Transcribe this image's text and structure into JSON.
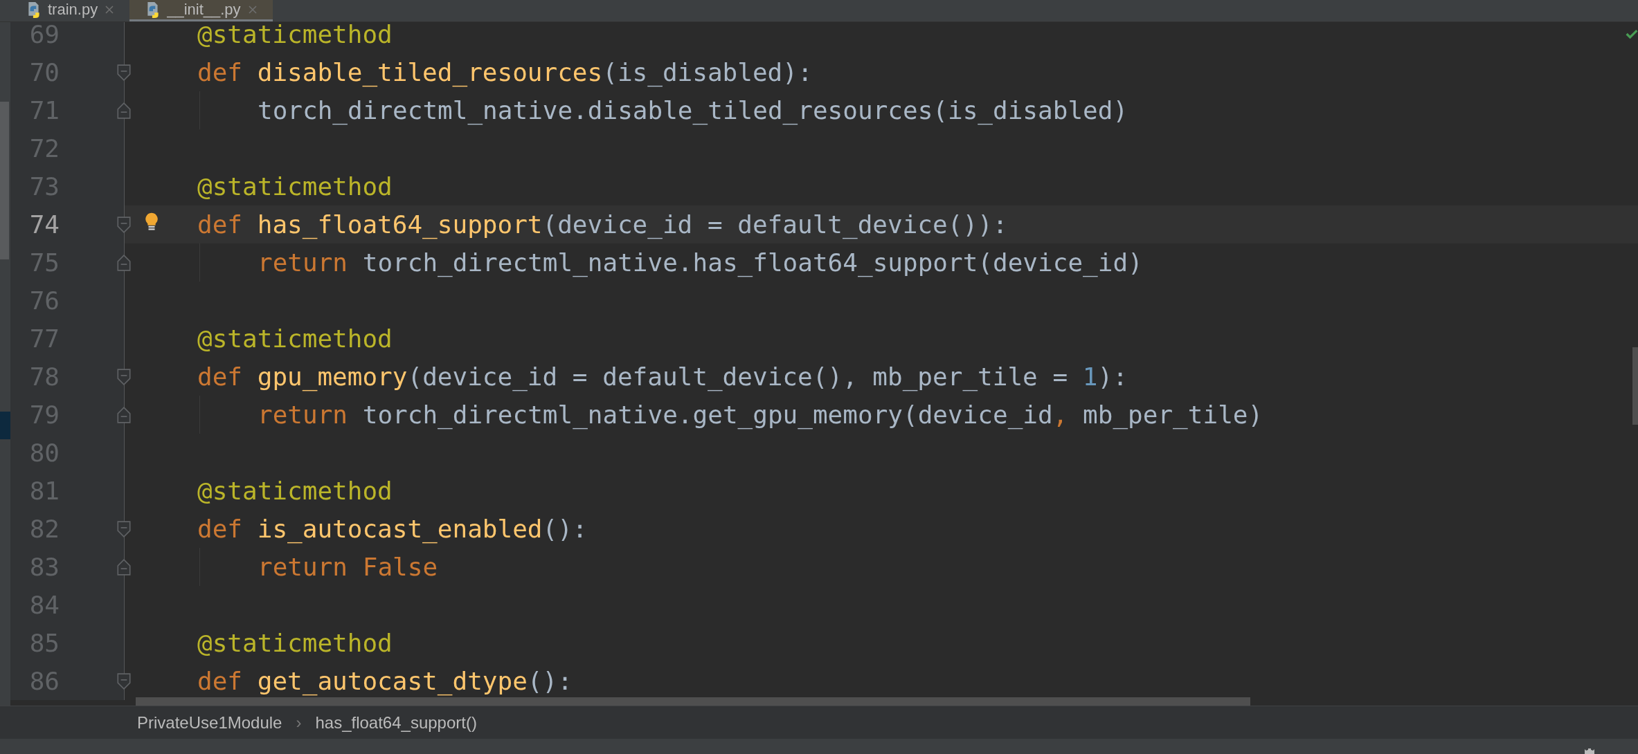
{
  "tabs": [
    {
      "label": "train.py",
      "selected": false
    },
    {
      "label": "__init__.py",
      "selected": true
    }
  ],
  "editor": {
    "inspection_ok": true,
    "lines": [
      {
        "number": "69",
        "fold_start": false,
        "fold_end": false,
        "indented": false,
        "current": false,
        "bulb": false,
        "tokens": [
          {
            "kind": "decorator",
            "text": "@staticmethod"
          }
        ]
      },
      {
        "number": "70",
        "fold_start": true,
        "fold_end": false,
        "indented": false,
        "current": false,
        "bulb": false,
        "tokens": [
          {
            "kind": "keyword",
            "text": "def "
          },
          {
            "kind": "function",
            "text": "disable_tiled_resources"
          },
          {
            "kind": "plain",
            "text": "(is_disabled):"
          }
        ]
      },
      {
        "number": "71",
        "fold_start": false,
        "fold_end": true,
        "indented": true,
        "current": false,
        "bulb": false,
        "tokens": [
          {
            "kind": "plain",
            "text": "torch_directml_native.disable_tiled_resources(is_disabled)"
          }
        ]
      },
      {
        "number": "72",
        "fold_start": false,
        "fold_end": false,
        "indented": false,
        "current": false,
        "bulb": false
      },
      {
        "number": "73",
        "fold_start": false,
        "fold_end": false,
        "indented": false,
        "current": false,
        "bulb": false,
        "tokens": [
          {
            "kind": "decorator",
            "text": "@staticmethod"
          }
        ]
      },
      {
        "number": "74",
        "fold_start": true,
        "fold_end": false,
        "indented": false,
        "current": true,
        "bulb": true,
        "tokens": [
          {
            "kind": "keyword",
            "text": "def "
          },
          {
            "kind": "function",
            "text": "has_float64_support"
          },
          {
            "kind": "plain",
            "text": "(device_id = default_device()):"
          }
        ]
      },
      {
        "number": "75",
        "fold_start": false,
        "fold_end": true,
        "indented": true,
        "current": false,
        "bulb": false,
        "tokens": [
          {
            "kind": "keyword",
            "text": "return "
          },
          {
            "kind": "plain",
            "text": "torch_directml_native.has_float64_support(device_id)"
          }
        ]
      },
      {
        "number": "76",
        "fold_start": false,
        "fold_end": false,
        "indented": false,
        "current": false,
        "bulb": false
      },
      {
        "number": "77",
        "fold_start": false,
        "fold_end": false,
        "indented": false,
        "current": false,
        "bulb": false,
        "tokens": [
          {
            "kind": "decorator",
            "text": "@staticmethod"
          }
        ]
      },
      {
        "number": "78",
        "fold_start": true,
        "fold_end": false,
        "indented": false,
        "current": false,
        "bulb": false,
        "tokens": [
          {
            "kind": "keyword",
            "text": "def "
          },
          {
            "kind": "function",
            "text": "gpu_memory"
          },
          {
            "kind": "plain",
            "text": "(device_id = default_device(), mb_per_tile = "
          },
          {
            "kind": "number",
            "text": "1"
          },
          {
            "kind": "plain",
            "text": "):"
          }
        ]
      },
      {
        "number": "79",
        "fold_start": false,
        "fold_end": true,
        "indented": true,
        "current": false,
        "bulb": false,
        "tokens": [
          {
            "kind": "keyword",
            "text": "return "
          },
          {
            "kind": "plain",
            "text": "torch_directml_native.get_gpu_memory(device_id"
          },
          {
            "kind": "keyword",
            "text": ", "
          },
          {
            "kind": "plain",
            "text": "mb_per_tile)"
          }
        ]
      },
      {
        "number": "80",
        "fold_start": false,
        "fold_end": false,
        "indented": false,
        "current": false,
        "bulb": false
      },
      {
        "number": "81",
        "fold_start": false,
        "fold_end": false,
        "indented": false,
        "current": false,
        "bulb": false,
        "tokens": [
          {
            "kind": "decorator",
            "text": "@staticmethod"
          }
        ]
      },
      {
        "number": "82",
        "fold_start": true,
        "fold_end": false,
        "indented": false,
        "current": false,
        "bulb": false,
        "tokens": [
          {
            "kind": "keyword",
            "text": "def "
          },
          {
            "kind": "function",
            "text": "is_autocast_enabled"
          },
          {
            "kind": "plain",
            "text": "():"
          }
        ]
      },
      {
        "number": "83",
        "fold_start": false,
        "fold_end": true,
        "indented": true,
        "current": false,
        "bulb": false,
        "tokens": [
          {
            "kind": "keyword",
            "text": "return False"
          }
        ]
      },
      {
        "number": "84",
        "fold_start": false,
        "fold_end": false,
        "indented": false,
        "current": false,
        "bulb": false
      },
      {
        "number": "85",
        "fold_start": false,
        "fold_end": false,
        "indented": false,
        "current": false,
        "bulb": false,
        "tokens": [
          {
            "kind": "decorator",
            "text": "@staticmethod"
          }
        ]
      },
      {
        "number": "86",
        "fold_start": true,
        "fold_end": false,
        "indented": false,
        "current": false,
        "bulb": false,
        "tokens": [
          {
            "kind": "keyword",
            "text": "def "
          },
          {
            "kind": "function",
            "text": "get_autocast_dtype"
          },
          {
            "kind": "plain",
            "text": "():"
          }
        ]
      }
    ]
  },
  "breadcrumb": {
    "separator": "›",
    "items": [
      "PrivateUse1Module",
      "has_float64_support()"
    ]
  }
}
